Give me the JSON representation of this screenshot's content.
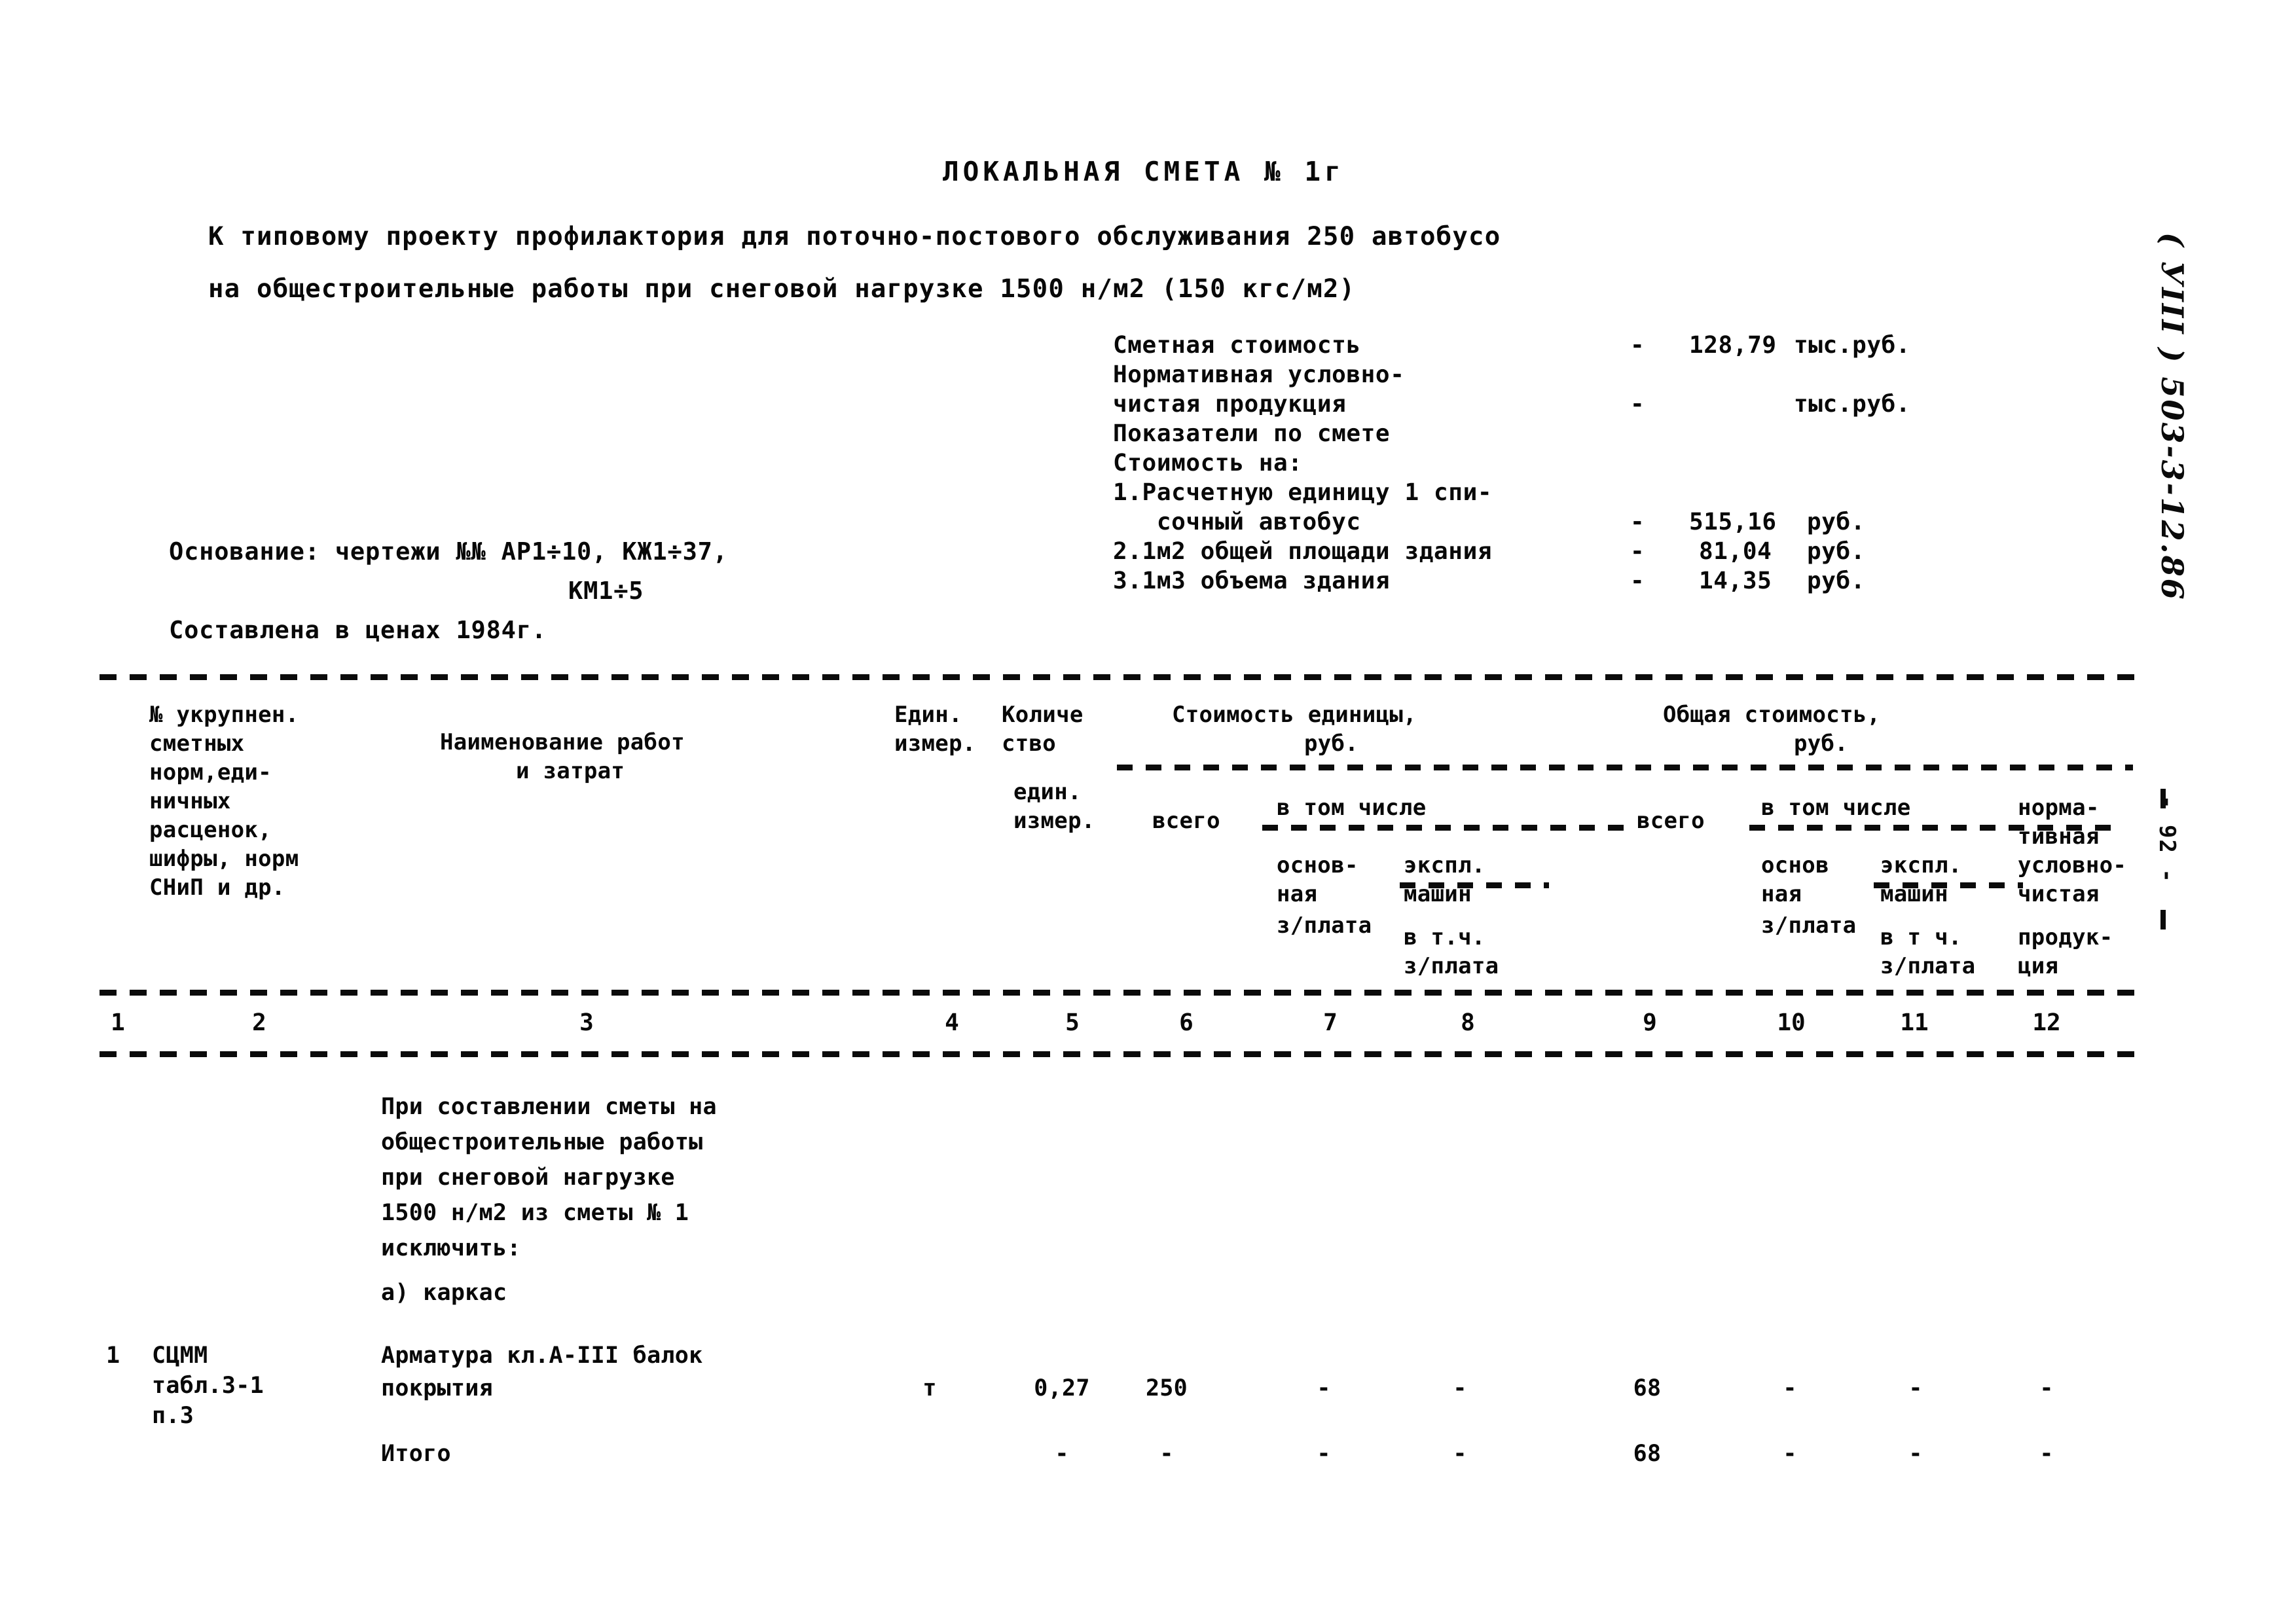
{
  "document": {
    "title": "ЛОКАЛЬНАЯ СМЕТА № 1г",
    "subtitle_line1": "К типовому проекту профилактория для поточно-постового обслуживания 250 автобусо",
    "subtitle_line2": "на общестроительные работы при снеговой нагрузке 1500 н/м2 (150 кгс/м2)",
    "margin_code": "( УIII ) 503-3-12.86",
    "page_number": "- 92 -"
  },
  "summary": {
    "rows": [
      {
        "label": "Сметная стоимость",
        "dash": "-",
        "value": "128,79",
        "unit": "тыс.руб."
      },
      {
        "label": "Нормативная условно-",
        "dash": "",
        "value": "",
        "unit": ""
      },
      {
        "label": "чистая продукция",
        "dash": "-",
        "value": "",
        "unit": "тыс.руб."
      },
      {
        "label": "Показатели по смете",
        "dash": "",
        "value": "",
        "unit": ""
      },
      {
        "label": "Стоимость на:",
        "dash": "",
        "value": "",
        "unit": ""
      },
      {
        "label": "1.Расчетную единицу 1 спи-",
        "dash": "",
        "value": "",
        "unit": ""
      },
      {
        "label": "   сочный автобус",
        "dash": "-",
        "value": "515,16",
        "unit": "руб."
      },
      {
        "label": "2.1м2 общей площади здания",
        "dash": "-",
        "value": "81,04",
        "unit": "руб."
      },
      {
        "label": "3.1м3 объема здания",
        "dash": "-",
        "value": "14,35",
        "unit": "руб."
      }
    ]
  },
  "basis": {
    "line1": "Основание: чертежи №№ АР1÷10, КЖ1÷37,",
    "line2": "КМ1÷5",
    "line3": "Составлена в ценах 1984г."
  },
  "table": {
    "headers": {
      "col1": "№ укрупнен.\nсметных\nнорм,еди-\nничных\nрасценок,\nшифры, норм\nСНиП и др.",
      "col3_line1": "Наименование работ",
      "col3_line2": "и затрат",
      "col4_line1": "Един.",
      "col4_line2": "измер.",
      "col5_line1": "Количе",
      "col5_line2": "ство",
      "col5_line3": "един.",
      "col5_line4": "измер.",
      "group_unit_cost_line1": "Стоимость единицы,",
      "group_unit_cost_line2": "руб.",
      "group_total_cost_line1": "Общая стоимость,",
      "group_total_cost_line2": "руб.",
      "unit_total": "всего",
      "unit_among": "в том числе",
      "unit_basic_1": "основ-",
      "unit_basic_2": "ная",
      "unit_basic_3": "з/плата",
      "unit_mach_1": "экспл.",
      "unit_mach_2": "машин",
      "unit_mach_3": "в т.ч.",
      "unit_mach_4": "з/плата",
      "total_total": "всего",
      "total_among": "в том числе",
      "total_basic_1": "основ",
      "total_basic_2": "ная",
      "total_basic_3": "з/плата",
      "total_mach_1": "экспл.",
      "total_mach_2": "машин",
      "total_mach_3": "в т ч.",
      "total_mach_4": "з/плата",
      "nchp_1": "норма-",
      "nchp_2": "тивная",
      "nchp_3": "условно-",
      "nchp_4": "чистая",
      "nchp_5": "продук-",
      "nchp_6": "ция"
    },
    "column_numbers": [
      "1",
      "2",
      "3",
      "4",
      "5",
      "6",
      "7",
      "8",
      "9",
      "10",
      "11",
      "12"
    ],
    "note_block": [
      "При составлении сметы на",
      "общестроительные работы",
      "при снеговой нагрузке",
      "1500 н/м2 из сметы № 1",
      "исключить:"
    ],
    "note_item": "а) каркас",
    "rows": [
      {
        "num": "1",
        "code": "СЦММ\nтабл.3-1\nп.3",
        "name_line1": "Арматура кл.А-III балок",
        "name_line2": "покрытия",
        "unit": "т",
        "qty": "0,27",
        "c6": "250",
        "c7": "-",
        "c8": "-",
        "c9": "68",
        "c10": "-",
        "c11": "-",
        "c12": "-"
      },
      {
        "num": "",
        "code": "",
        "name_line1": "Итого",
        "name_line2": "",
        "unit": "",
        "qty": "-",
        "c6": "-",
        "c7": "-",
        "c8": "-",
        "c9": "68",
        "c10": "-",
        "c11": "-",
        "c12": "-"
      }
    ]
  }
}
